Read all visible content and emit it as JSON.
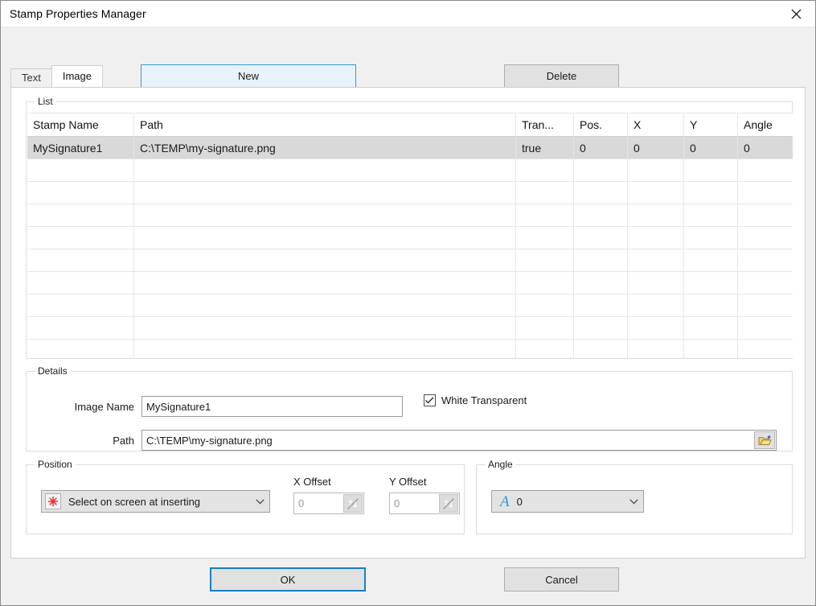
{
  "window": {
    "title": "Stamp Properties Manager",
    "close_icon": "close-icon"
  },
  "toolbar": {
    "new_label": "New",
    "delete_label": "Delete"
  },
  "tabs": [
    {
      "label": "Text",
      "active": false
    },
    {
      "label": "Image",
      "active": true
    }
  ],
  "list_group": {
    "title": "List",
    "columns": [
      "Stamp Name",
      "Path",
      "Tran...",
      "Pos.",
      "X",
      "Y",
      "Angle"
    ],
    "rows": [
      {
        "stamp_name": "MySignature1",
        "path": "C:\\TEMP\\my-signature.png",
        "transparent": "true",
        "pos": "0",
        "x": "0",
        "y": "0",
        "angle": "0",
        "selected": true
      }
    ],
    "empty_row_count": 9
  },
  "details": {
    "title": "Details",
    "image_name_label": "Image Name",
    "image_name_value": "MySignature1",
    "path_label": "Path",
    "path_value": "C:\\TEMP\\my-signature.png",
    "browse_icon": "open-folder-icon",
    "white_transparent_label": "White Transparent",
    "white_transparent_checked": true
  },
  "position": {
    "title": "Position",
    "mode_icon": "red-asterisk-icon",
    "mode_value": "Select on screen at inserting",
    "x_offset_label": "X Offset",
    "x_offset_value": "0",
    "y_offset_label": "Y Offset",
    "y_offset_value": "0",
    "spinner_icon": "spinner-disabled-icon"
  },
  "angle": {
    "title": "Angle",
    "icon": "italic-a-icon",
    "value": "0"
  },
  "footer": {
    "ok_label": "OK",
    "cancel_label": "Cancel"
  },
  "colors": {
    "accent": "#1a7fc4",
    "new_button_fill": "#e8f2fb",
    "selection": "#d9d9d9",
    "folder_icon": "#e8c45a",
    "asterisk": "#e8323c",
    "angle_a": "#2e9bd6"
  }
}
